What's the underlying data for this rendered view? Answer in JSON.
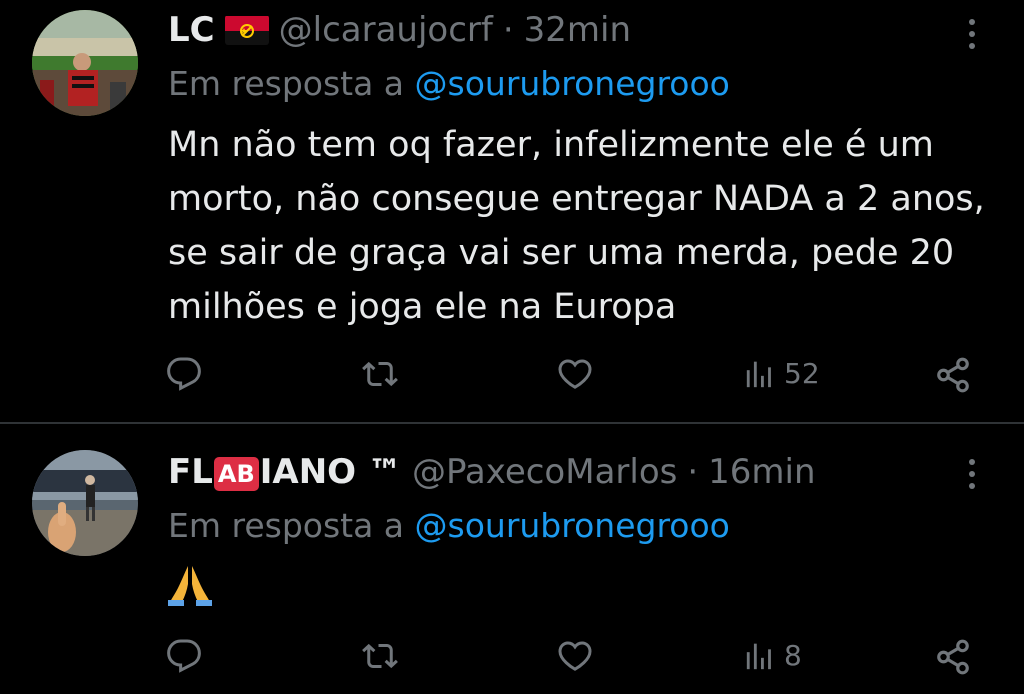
{
  "colors": {
    "background": "#000000",
    "text_primary": "#e7e9ea",
    "text_secondary": "#71767b",
    "link": "#1d9bf0",
    "divider": "#2f3336",
    "badge_red": "#dd2e44"
  },
  "tweets": [
    {
      "name": "LC",
      "name_flag_icon": "angola-flag-icon",
      "handle": "@lcaraujocrf",
      "separator": "·",
      "time": "32min",
      "reply_prefix": "Em resposta a",
      "reply_mention": "@sourubronegrooo",
      "text": "Mn não tem oq fazer, infelizmente ele é um morto, não consegue entregar NADA a 2 anos, se sair de graça vai ser uma merda, pede 20 milhões e joga ele na Europa",
      "views": "52"
    },
    {
      "name_prefix": "FL",
      "name_badge": "AB",
      "name_suffix": "IANO ™",
      "handle": "@PaxecoMarlos",
      "separator": "·",
      "time": "16min",
      "reply_prefix": "Em resposta a",
      "reply_mention": "@sourubronegrooo",
      "text_icon": "folded-hands-emoji-icon",
      "views": "8"
    }
  ]
}
